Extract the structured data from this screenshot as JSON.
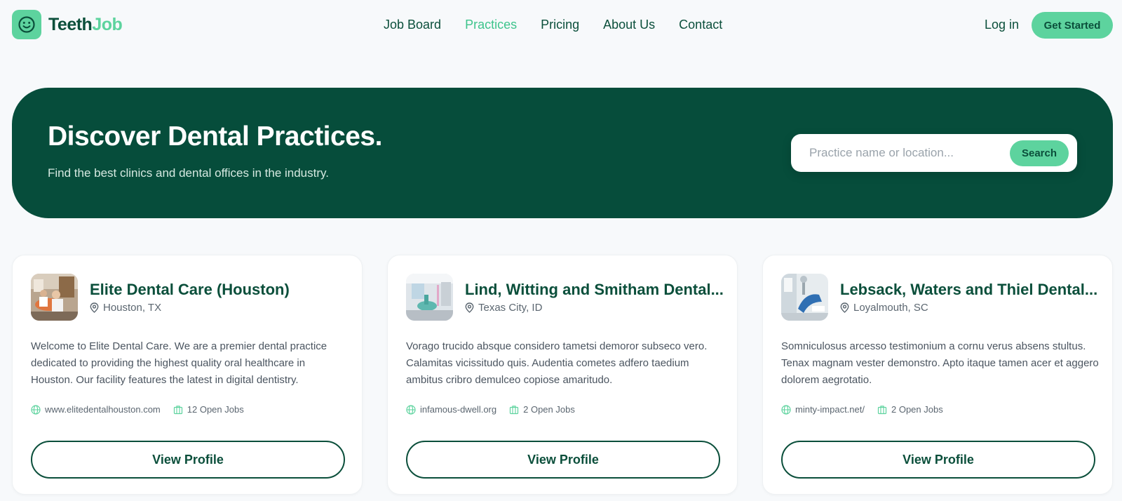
{
  "brand": {
    "name_part1": "Teeth",
    "name_part2": "Job",
    "icon": "smile-icon",
    "colors": {
      "primary": "#0b4f3b",
      "accent": "#5dd39e",
      "hero_bg": "#064d3b"
    }
  },
  "nav": {
    "items": [
      {
        "label": "Job Board",
        "active": false
      },
      {
        "label": "Practices",
        "active": true
      },
      {
        "label": "Pricing",
        "active": false
      },
      {
        "label": "About Us",
        "active": false
      },
      {
        "label": "Contact",
        "active": false
      }
    ],
    "login_label": "Log in",
    "cta_label": "Get Started"
  },
  "hero": {
    "title": "Discover Dental Practices.",
    "subtitle": "Find the best clinics and dental offices in the industry.",
    "search": {
      "placeholder": "Practice name or location...",
      "value": "",
      "button_label": "Search"
    }
  },
  "practices": [
    {
      "name": "Elite Dental Care (Houston)",
      "location": "Houston, TX",
      "description": "Welcome to Elite Dental Care. We are a premier dental practice dedicated to providing the highest quality oral healthcare in Houston. Our facility features the latest in digital dentistry.",
      "website": "www.elitedentalhouston.com",
      "open_jobs": "12 Open Jobs",
      "button_label": "View Profile"
    },
    {
      "name": "Lind, Witting and Smitham Dental...",
      "location": "Texas City, ID",
      "description": "Vorago trucido absque considero tametsi demoror subseco vero. Calamitas vicissitudo quis. Audentia cometes adfero taedium ambitus cribro demulceo copiose amaritudo.",
      "website": "infamous-dwell.org",
      "open_jobs": "2 Open Jobs",
      "button_label": "View Profile"
    },
    {
      "name": "Lebsack, Waters and Thiel Dental...",
      "location": "Loyalmouth, SC",
      "description": "Somniculosus arcesso testimonium a cornu verus absens stultus. Tenax magnam vester demonstro. Apto itaque tamen acer et aggero dolorem aegrotatio.",
      "website": "minty-impact.net/",
      "open_jobs": "2 Open Jobs",
      "button_label": "View Profile"
    }
  ]
}
